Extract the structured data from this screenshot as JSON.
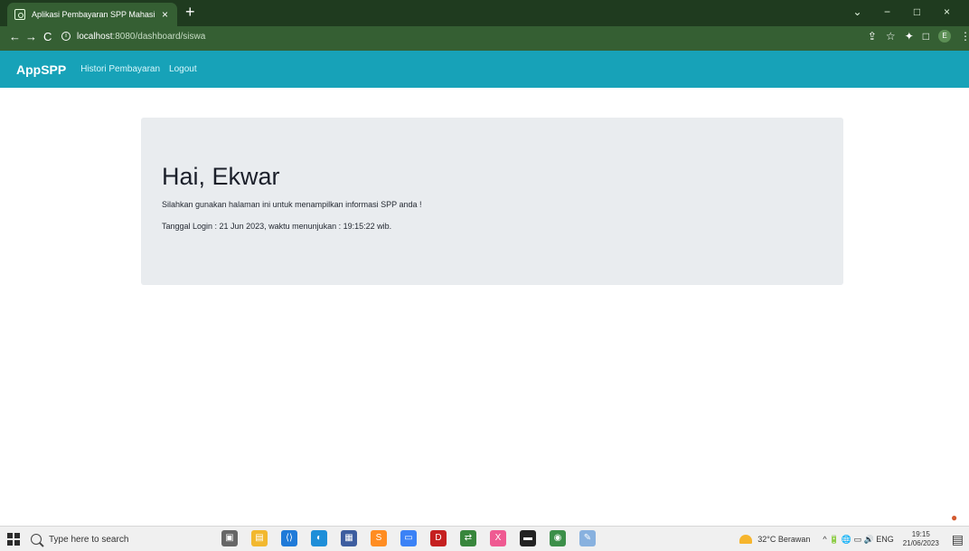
{
  "browser": {
    "tab_title": "Aplikasi Pembayaran SPP Mahasi",
    "tab_close": "×",
    "new_tab": "+",
    "url_host": "localhost",
    "url_rest": ":8080/dashboard/siswa",
    "controls": {
      "back": "←",
      "forward": "→",
      "reload": "C",
      "info": "i",
      "share": "⇪",
      "bookmark": "☆",
      "extensions": "✦",
      "sidebar": "□",
      "menu": "⋮",
      "profile": "E"
    },
    "window": {
      "chevron": "⌄",
      "minimize": "−",
      "maximize": "□",
      "close": "×"
    }
  },
  "app": {
    "brand": "AppSPP",
    "nav": [
      "Histori Pembayaran",
      "Logout"
    ]
  },
  "dashboard": {
    "heading": "Hai, Ekwar",
    "message": "Silahkan gunakan halaman ini untuk menampilkan informasi SPP anda !",
    "login_info": "Tanggal Login : 21 Jun 2023, waktu menunjukan : 19:15:22 wib."
  },
  "taskbar": {
    "search_placeholder": "Type here to search",
    "weather": "32°C Berawan",
    "tray": "^  🔋  🌐  ▭  🔊  ENG",
    "time": "19:15",
    "date": "21/06/2023"
  },
  "colors": {
    "browser_top": "#1f3b1f",
    "browser_bar": "#355f33",
    "navbar": "#17a2b8",
    "jumbotron": "#e9ecef"
  }
}
